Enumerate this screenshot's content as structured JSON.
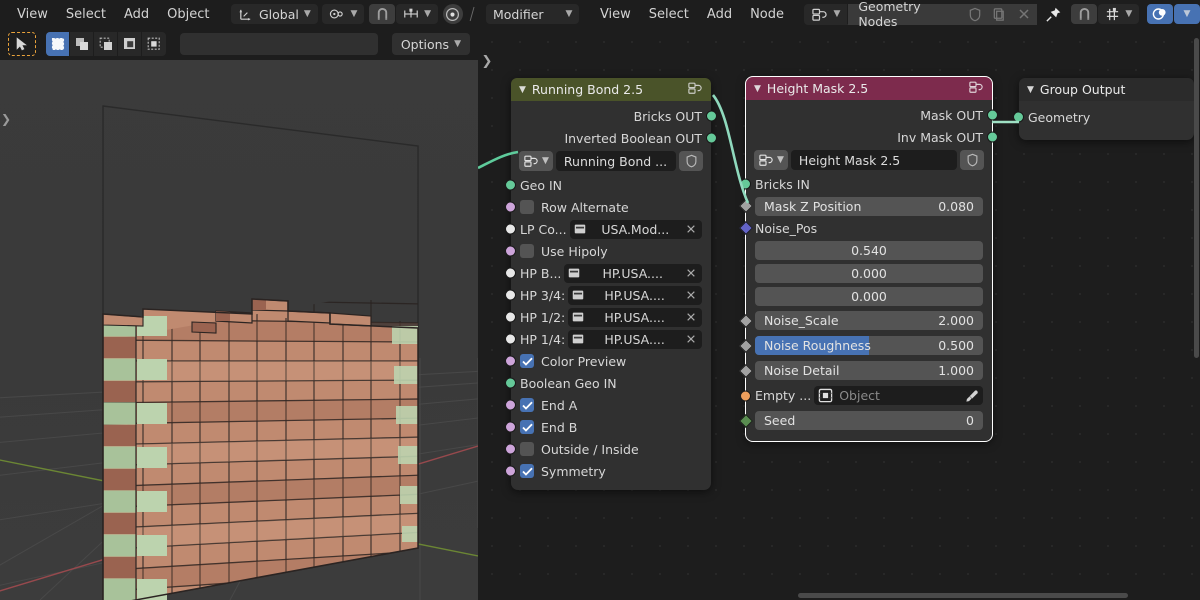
{
  "viewport_header": {
    "menus": [
      "View",
      "Select",
      "Add",
      "Object"
    ],
    "transform_orientation": "Global",
    "orientation_icon": "transform-orientation-icon",
    "pivot_icon": "pivot-point-icon",
    "snap_icon": "magnet-icon",
    "snap_target_icon": "snap-increment-icon",
    "proportional_icon": "proportional-editing-icon"
  },
  "viewport_tools": {
    "cursor_icon": "tweak-cursor-icon",
    "select_modes": [
      {
        "name": "select-box",
        "icon": "select-box-icon",
        "active": true
      },
      {
        "name": "select-extend",
        "icon": "select-extend-icon",
        "active": false
      },
      {
        "name": "select-subtract",
        "icon": "select-subtract-icon",
        "active": false
      },
      {
        "name": "select-invert",
        "icon": "select-invert-icon",
        "active": false
      },
      {
        "name": "select-intersect",
        "icon": "select-intersect-icon",
        "active": false
      }
    ],
    "options_label": "Options",
    "sidebar_toggle_icon": "chevron-right-icon"
  },
  "node_header": {
    "editor_type_icon": "geometry-nodes-editor-icon",
    "modifier_dropdown": "Modifier",
    "menus": [
      "View",
      "Select",
      "Add",
      "Node"
    ],
    "browse_icon": "browse-nodetree-icon",
    "nodetree_name": "Geometry Nodes",
    "shield_icon": "fake-user-icon",
    "duplicate_icon": "new-nodetree-icon",
    "unlink_icon": "unlink-icon",
    "pin_icon": "pin-icon",
    "snap_icon": "magnet-icon",
    "snap_mode_icon": "snap-grid-icon",
    "overlays_icon": "overlays-icon"
  },
  "node_editor": {
    "sidebar_toggle_icon": "chevron-right-icon",
    "scrollbar_v": "vertical-scrollbar",
    "scrollbar_h": "horizontal-scrollbar"
  },
  "nodes": [
    {
      "id": "running-bond",
      "title": "Running Bond 2.5",
      "header_color": "#4a5329",
      "header_icon": "node-group-icon",
      "collapse_icon": "chevron-down-icon",
      "outputs": [
        {
          "label": "Bricks OUT",
          "socket": "geo"
        },
        {
          "label": "Inverted Boolean OUT",
          "socket": "geo"
        }
      ],
      "name_widget": {
        "dropdown_icon": "browse-nodegroup-icon",
        "value": "Running Bond ...",
        "shield_icon": "fake-user-icon"
      },
      "inputs": [
        {
          "type": "socket_label",
          "label": "Geo IN",
          "socket": "geo"
        },
        {
          "type": "checkbox",
          "label": "Row Alternate",
          "checked": false,
          "socket": "bool"
        },
        {
          "type": "id",
          "label": "LP Co...",
          "value": "USA.Mod...",
          "socket": "mat",
          "icon": "collection-icon",
          "clear_icon": "x-icon"
        },
        {
          "type": "checkbox",
          "label": "Use Hipoly",
          "checked": false,
          "socket": "bool"
        },
        {
          "type": "id",
          "label": "HP B...",
          "value": "HP.USA....",
          "socket": "mat",
          "icon": "collection-icon",
          "clear_icon": "x-icon"
        },
        {
          "type": "id",
          "label": "HP 3/4:",
          "value": "HP.USA....",
          "socket": "mat",
          "icon": "collection-icon",
          "clear_icon": "x-icon"
        },
        {
          "type": "id",
          "label": "HP 1/2:",
          "value": "HP.USA....",
          "socket": "mat",
          "icon": "collection-icon",
          "clear_icon": "x-icon"
        },
        {
          "type": "id",
          "label": "HP 1/4:",
          "value": "HP.USA....",
          "socket": "mat",
          "icon": "collection-icon",
          "clear_icon": "x-icon"
        },
        {
          "type": "checkbox",
          "label": "Color Preview",
          "checked": true,
          "socket": "bool"
        },
        {
          "type": "socket_label",
          "label": "Boolean Geo IN",
          "socket": "geo"
        },
        {
          "type": "checkbox",
          "label": "End A",
          "checked": true,
          "socket": "bool"
        },
        {
          "type": "checkbox",
          "label": "End B",
          "checked": true,
          "socket": "bool"
        },
        {
          "type": "checkbox",
          "label": "Outside / Inside",
          "checked": false,
          "socket": "bool"
        },
        {
          "type": "checkbox",
          "label": "Symmetry",
          "checked": true,
          "socket": "bool"
        }
      ]
    },
    {
      "id": "height-mask",
      "title": "Height Mask 2.5",
      "header_color": "#7d2b4d",
      "header_icon": "node-group-icon",
      "collapse_icon": "chevron-down-icon",
      "selected": true,
      "outputs": [
        {
          "label": "Mask OUT",
          "socket": "geo"
        },
        {
          "label": "Inv Mask OUT",
          "socket": "geo"
        }
      ],
      "name_widget": {
        "dropdown_icon": "browse-nodegroup-icon",
        "value": "Height Mask 2.5",
        "shield_icon": "fake-user-icon"
      },
      "inputs": [
        {
          "type": "socket_label",
          "label": "Bricks IN",
          "socket": "geo"
        },
        {
          "type": "value",
          "label": "Mask Z Position",
          "value": "0.080",
          "socket": "float"
        },
        {
          "type": "socket_label",
          "label": "Noise_Pos",
          "socket": "vector"
        },
        {
          "type": "vector_component",
          "value": "0.540"
        },
        {
          "type": "vector_component",
          "value": "0.000"
        },
        {
          "type": "vector_component",
          "value": "0.000"
        },
        {
          "type": "value",
          "label": "Noise_Scale",
          "value": "2.000",
          "socket": "float"
        },
        {
          "type": "value",
          "label": "Noise Roughness",
          "value": "0.500",
          "socket": "float",
          "slider_fill": 50
        },
        {
          "type": "value",
          "label": "Noise Detail",
          "value": "1.000",
          "socket": "float"
        },
        {
          "type": "object",
          "label": "Empty ...",
          "placeholder": "Object",
          "socket": "object",
          "icon": "empty-axes-icon",
          "eyedropper_icon": "eyedropper-icon"
        },
        {
          "type": "value",
          "label": "Seed",
          "value": "0",
          "socket": "int"
        }
      ]
    },
    {
      "id": "group-output",
      "title": "Group Output",
      "header_color": "#2b2b2b",
      "collapse_icon": "chevron-down-icon",
      "inputs": [
        {
          "type": "socket_label",
          "label": "Geometry",
          "socket": "geo"
        }
      ]
    }
  ],
  "links": [
    {
      "from": "offscreen",
      "to": "running-bond.Geo IN"
    },
    {
      "from": "running-bond.Bricks OUT",
      "to": "height-mask.Bricks IN"
    },
    {
      "from": "height-mask.Mask OUT",
      "to": "group-output.Geometry"
    }
  ],
  "scene": {
    "description": "brick-wall-3d-model",
    "brick_color": "#c98f75",
    "brick_dark_color": "#a06a52",
    "brick_green_color": "#a8c29a",
    "grid_axis_x_color": "#9c4a4e",
    "grid_axis_y_color": "#6e8a34",
    "background_color": "#3b3b3b"
  }
}
